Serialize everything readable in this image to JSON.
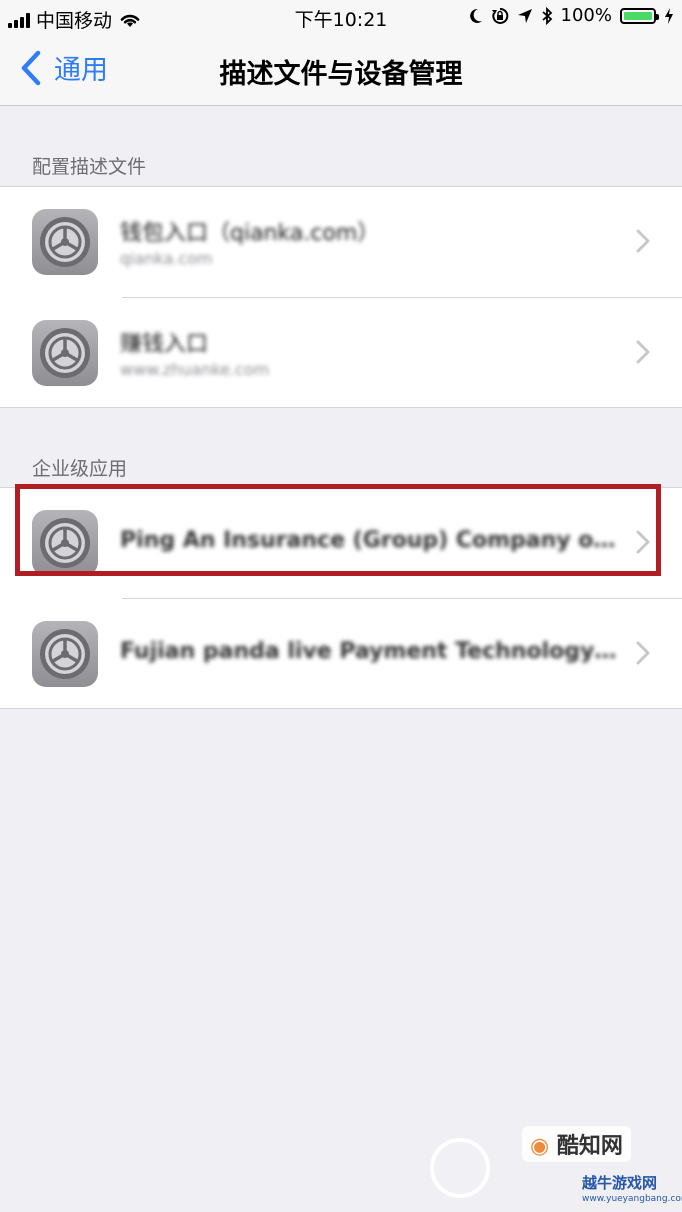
{
  "status_bar": {
    "carrier": "中国移动",
    "time": "下午10:21",
    "battery": "100%",
    "battery_level": 1.0,
    "icons": [
      "signal-icon",
      "wifi-icon",
      "moon-icon",
      "orientation-lock-icon",
      "location-icon",
      "bluetooth-icon",
      "battery-icon",
      "charging-icon"
    ]
  },
  "nav": {
    "back_label": "通用",
    "title": "描述文件与设备管理"
  },
  "profiles": {
    "header": "配置描述文件",
    "items": [
      {
        "title": "钱包入口（qianka.com）",
        "subtitle": "qianka.com",
        "icon": "settings-gear-icon"
      },
      {
        "title": "赚钱入口",
        "subtitle": "www.zhuanke.com",
        "icon": "settings-gear-icon"
      }
    ]
  },
  "enterprise": {
    "header": "企业级应用",
    "items": [
      {
        "title": "Ping An Insurance (Group) Company of Chin…",
        "icon": "settings-gear-icon",
        "highlighted": true
      },
      {
        "title": "Fujian panda live Payment Technology Co., L…",
        "icon": "settings-gear-icon",
        "highlighted": false
      }
    ]
  },
  "watermark": {
    "brand": "酷知网",
    "name": "越牛游戏网",
    "url": "www.yueyangbang.com"
  },
  "colors": {
    "accent": "#2f7df6",
    "highlight": "#b01e23",
    "battery": "#4cd964",
    "background": "#efeff4"
  }
}
